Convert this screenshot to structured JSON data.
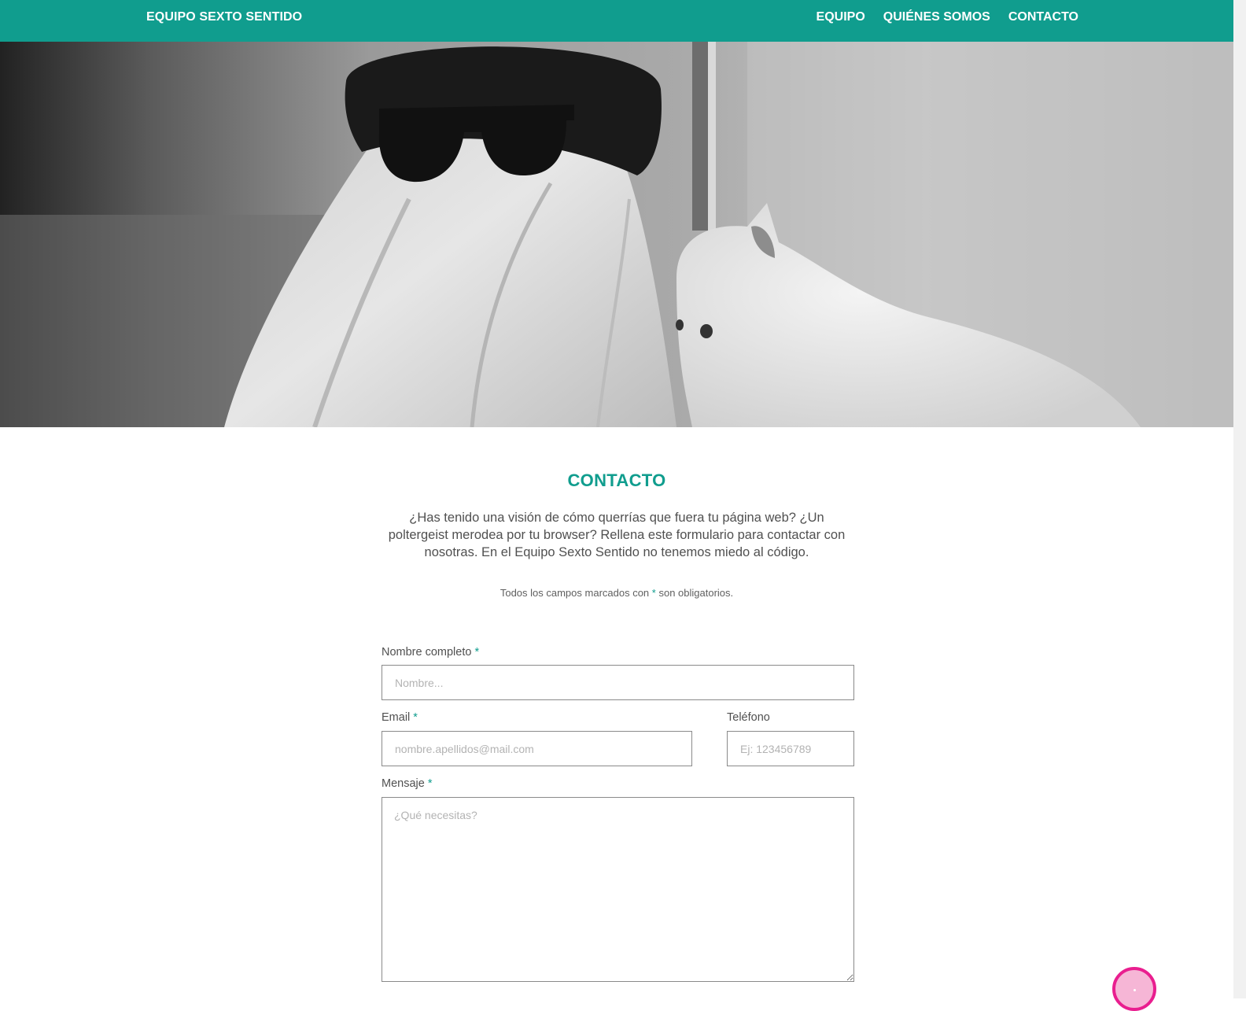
{
  "header": {
    "brand": "EQUIPO SEXTO SENTIDO",
    "nav": [
      {
        "label": "EQUIPO"
      },
      {
        "label": "QUIÉNES SOMOS"
      },
      {
        "label": "CONTACTO"
      }
    ]
  },
  "colors": {
    "accent": "#109d8e",
    "fab_border": "#e91e8f",
    "fab_fill": "#f6b6d6"
  },
  "hero": {
    "image": "ghost-with-sunglasses-and-cat-photo"
  },
  "contact": {
    "title": "CONTACTO",
    "intro": "¿Has tenido una visión de cómo querrías que fuera tu página web? ¿Un poltergeist merodea por tu browser? Rellena este formulario para contactar con nosotras. En el Equipo Sexto Sentido no tenemos miedo al código.",
    "required_note_prefix": "Todos los campos marcados con",
    "required_note_star": "*",
    "required_note_suffix": "son obligatorios.",
    "fields": {
      "name": {
        "label": "Nombre completo",
        "required": "*",
        "placeholder": "Nombre..."
      },
      "email": {
        "label": "Email",
        "required": "*",
        "placeholder": "nombre.apellidos@mail.com"
      },
      "phone": {
        "label": "Teléfono",
        "placeholder": "Ej: 123456789"
      },
      "message": {
        "label": "Mensaje",
        "required": "*",
        "placeholder": "¿Qué necesitas?"
      }
    }
  }
}
